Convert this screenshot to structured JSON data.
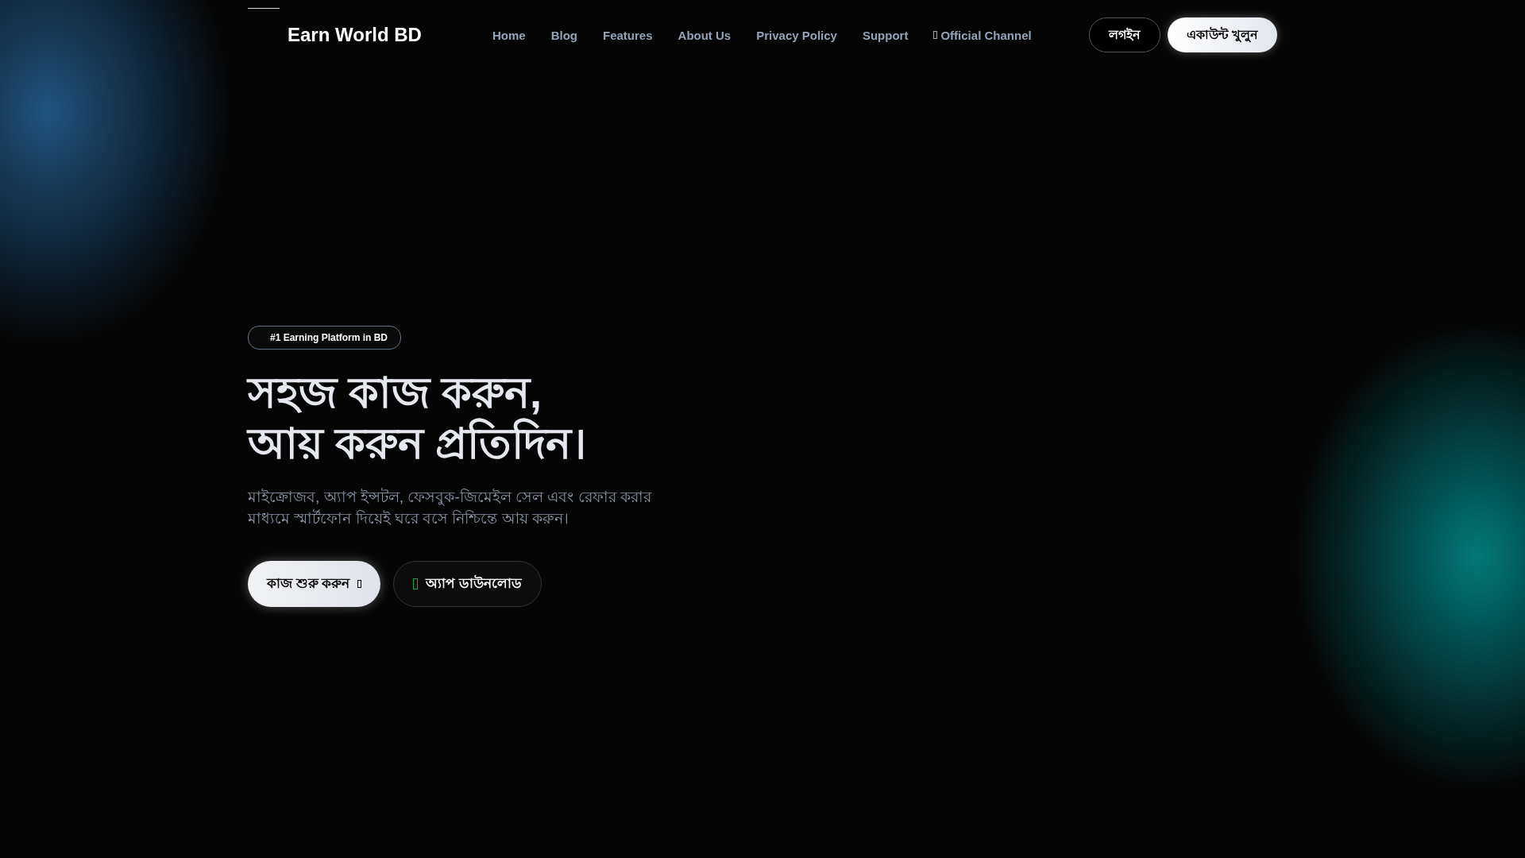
{
  "header": {
    "brand": "Earn World BD",
    "nav": [
      {
        "label": "Home"
      },
      {
        "label": "Blog"
      },
      {
        "label": "Features"
      },
      {
        "label": "About Us"
      },
      {
        "label": "Privacy Policy"
      },
      {
        "label": "Support"
      },
      {
        "label": "Official Channel",
        "icon": true
      }
    ],
    "login": "লগইন",
    "signup": "একাউন্ট খুলুন"
  },
  "hero": {
    "badge": "#1 Earning Platform in BD",
    "title_lines": [
      "সহজ কাজ করুন,",
      "আয় করুন প্রতিদিন।"
    ],
    "description": "মাইক্রোজব, অ্যাপ ইন্সটল, ফেসবুক-জিমেইল সেল এবং রেফার করার মাধ্যমে স্মার্টফোন দিয়েই ঘরে বসে নিশ্চিন্তে আয় করুন।",
    "primary": "কাজ শুরু করুন",
    "secondary": "অ্যাপ ডাউনলোড"
  }
}
